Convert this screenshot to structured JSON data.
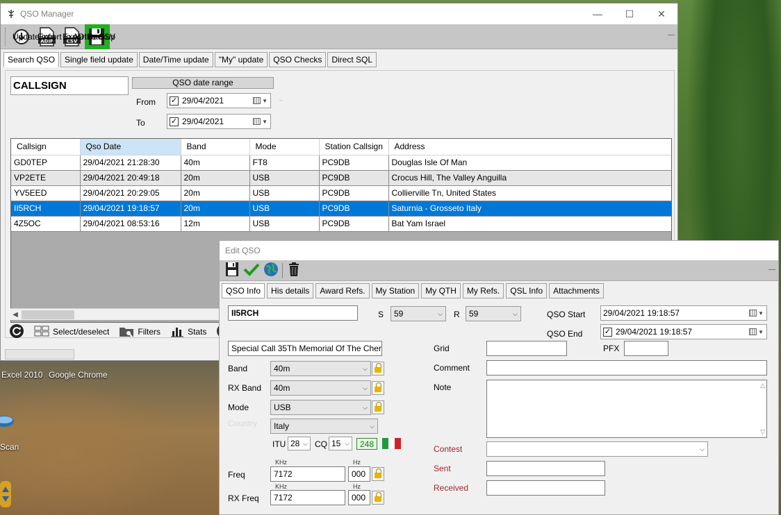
{
  "desktop": {
    "labels": [
      "Excel 2010",
      "Google Chrome",
      "Scan"
    ]
  },
  "main_window": {
    "title": "QSO Manager",
    "toolbar": [
      {
        "label": "Update info",
        "icon": "update-info-icon"
      },
      {
        "label": "Export to ADIF",
        "icon": "adif-file-icon"
      },
      {
        "label": "Export to CSV",
        "icon": "csv-file-icon"
      },
      {
        "label": "Backup",
        "icon": "floppy-disk-icon"
      }
    ],
    "tabs": [
      "Search QSO",
      "Single field update",
      "Date/Time update",
      "\"My\" update",
      "QSO Checks",
      "Direct SQL"
    ],
    "active_tab": "Search QSO",
    "search": {
      "callsign_placeholder": "CALLSIGN",
      "range_header": "QSO date range",
      "from_label": "From",
      "to_label": "To",
      "from_value": "29/04/2021",
      "to_value": "29/04/2021"
    },
    "grid": {
      "columns": [
        "Callsign",
        "Qso Date",
        "Band",
        "Mode",
        "Station Callsign",
        "Address"
      ],
      "rows": [
        [
          "GD0TEP",
          "29/04/2021 21:28:30",
          "40m",
          "FT8",
          "PC9DB",
          "Douglas Isle Of Man"
        ],
        [
          "VP2ETE",
          "29/04/2021 20:49:18",
          "20m",
          "USB",
          "PC9DB",
          "Crocus Hill, The Valley Anguilla"
        ],
        [
          "YV5EED",
          "29/04/2021 20:29:05",
          "20m",
          "USB",
          "PC9DB",
          "Collierville Tn, United States"
        ],
        [
          "II5RCH",
          "29/04/2021 19:18:57",
          "20m",
          "USB",
          "PC9DB",
          "Saturnia - Grosseto Italy"
        ],
        [
          "4Z5OC",
          "29/04/2021 08:53:16",
          "12m",
          "USB",
          "PC9DB",
          "Bat Yam Israel"
        ]
      ],
      "selected_row": 3
    },
    "bottom_bar": {
      "select_label": "Select/deselect",
      "filters_label": "Filters",
      "stats_label": "Stats"
    }
  },
  "edit_window": {
    "title": "Edit QSO",
    "tabs": [
      "QSO Info",
      "His details",
      "Award Refs.",
      "My Station",
      "My QTH",
      "My Refs.",
      "QSL Info",
      "Attachments"
    ],
    "active_tab": "QSO Info",
    "callsign": "II5RCH",
    "s_label": "S",
    "s_value": "59",
    "r_label": "R",
    "r_value": "59",
    "qso_start_label": "QSO Start",
    "qso_start_value": "29/04/2021 19:18:57",
    "qso_end_label": "QSO End",
    "qso_end_value": "29/04/2021 19:18:57",
    "comment_text": "Special Call 35Th Memorial Of The Cher",
    "band_label": "Band",
    "band_value": "40m",
    "rx_band_label": "RX Band",
    "rx_band_value": "40m",
    "mode_label": "Mode",
    "mode_value": "USB",
    "country_label": "Country",
    "country_value": "Italy",
    "itu_label": "ITU",
    "itu_value": "28",
    "cq_label": "CQ",
    "cq_value": "15",
    "dxcc_value": "248",
    "khz_unit": "KHz",
    "hz_unit": "Hz",
    "freq_label": "Freq",
    "freq_khz": "7172",
    "freq_hz": "000",
    "rx_freq_label": "RX Freq",
    "rx_freq_khz": "7172",
    "rx_freq_hz": "000",
    "grid_label": "Grid",
    "pfx_label": "PFX",
    "comment_label": "Comment",
    "note_label": "Note",
    "contest_label": "Contest",
    "sent_label": "Sent",
    "received_label": "Received"
  },
  "colors": {
    "selection": "#0078d7",
    "backup_green": "#21b021",
    "toolbar_gray": "#c6c6c6",
    "contest_label_red": "#a0282c"
  }
}
